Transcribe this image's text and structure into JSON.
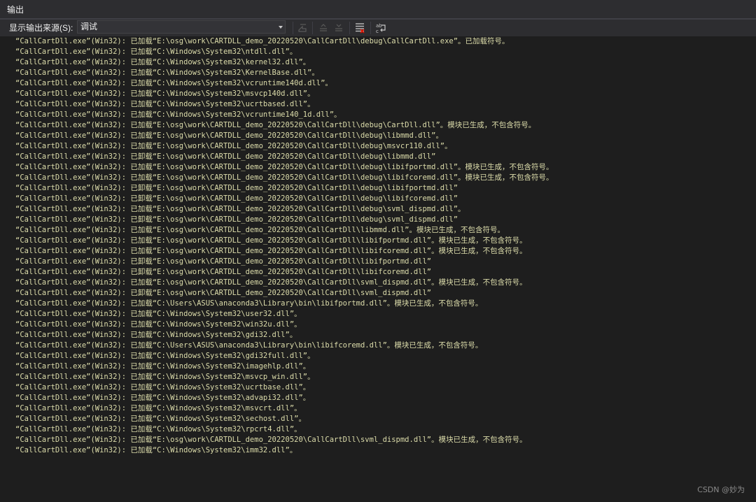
{
  "panel": {
    "title": "输出"
  },
  "toolbar": {
    "source_label": "显示输出来源(S):",
    "source_value": "调试",
    "buttons": [
      {
        "icon": "goto-line-icon",
        "enabled": false
      },
      {
        "icon": "previous-message-icon",
        "enabled": false
      },
      {
        "icon": "next-message-icon",
        "enabled": false
      },
      {
        "icon": "clear-all-icon",
        "enabled": true
      },
      {
        "icon": "word-wrap-icon",
        "enabled": true
      }
    ]
  },
  "output": {
    "lines": [
      "“CallCartDll.exe”(Win32): 已加载“E:\\osg\\work\\CARTDLL_demo_20220520\\CallCartDll\\debug\\CallCartDll.exe”。已加载符号。",
      "“CallCartDll.exe”(Win32): 已加载“C:\\Windows\\System32\\ntdll.dll”。",
      "“CallCartDll.exe”(Win32): 已加载“C:\\Windows\\System32\\kernel32.dll”。",
      "“CallCartDll.exe”(Win32): 已加载“C:\\Windows\\System32\\KernelBase.dll”。",
      "“CallCartDll.exe”(Win32): 已加载“C:\\Windows\\System32\\vcruntime140d.dll”。",
      "“CallCartDll.exe”(Win32): 已加载“C:\\Windows\\System32\\msvcp140d.dll”。",
      "“CallCartDll.exe”(Win32): 已加载“C:\\Windows\\System32\\ucrtbased.dll”。",
      "“CallCartDll.exe”(Win32): 已加载“C:\\Windows\\System32\\vcruntime140_1d.dll”。",
      "“CallCartDll.exe”(Win32): 已加载“E:\\osg\\work\\CARTDLL_demo_20220520\\CallCartDll\\debug\\CartDll.dll”。模块已生成，不包含符号。",
      "“CallCartDll.exe”(Win32): 已加载“E:\\osg\\work\\CARTDLL_demo_20220520\\CallCartDll\\debug\\libmmd.dll”。",
      "“CallCartDll.exe”(Win32): 已加载“E:\\osg\\work\\CARTDLL_demo_20220520\\CallCartDll\\debug\\msvcr110.dll”。",
      "“CallCartDll.exe”(Win32): 已卸载“E:\\osg\\work\\CARTDLL_demo_20220520\\CallCartDll\\debug\\libmmd.dll”",
      "“CallCartDll.exe”(Win32): 已加载“E:\\osg\\work\\CARTDLL_demo_20220520\\CallCartDll\\debug\\libifportmd.dll”。模块已生成，不包含符号。",
      "“CallCartDll.exe”(Win32): 已加载“E:\\osg\\work\\CARTDLL_demo_20220520\\CallCartDll\\debug\\libifcoremd.dll”。模块已生成，不包含符号。",
      "“CallCartDll.exe”(Win32): 已卸载“E:\\osg\\work\\CARTDLL_demo_20220520\\CallCartDll\\debug\\libifportmd.dll”",
      "“CallCartDll.exe”(Win32): 已卸载“E:\\osg\\work\\CARTDLL_demo_20220520\\CallCartDll\\debug\\libifcoremd.dll”",
      "“CallCartDll.exe”(Win32): 已加载“E:\\osg\\work\\CARTDLL_demo_20220520\\CallCartDll\\debug\\svml_dispmd.dll”。",
      "“CallCartDll.exe”(Win32): 已卸载“E:\\osg\\work\\CARTDLL_demo_20220520\\CallCartDll\\debug\\svml_dispmd.dll”",
      "“CallCartDll.exe”(Win32): 已加载“E:\\osg\\work\\CARTDLL_demo_20220520\\CallCartDll\\libmmd.dll”。模块已生成，不包含符号。",
      "“CallCartDll.exe”(Win32): 已加载“E:\\osg\\work\\CARTDLL_demo_20220520\\CallCartDll\\libifportmd.dll”。模块已生成，不包含符号。",
      "“CallCartDll.exe”(Win32): 已加载“E:\\osg\\work\\CARTDLL_demo_20220520\\CallCartDll\\libifcoremd.dll”。模块已生成，不包含符号。",
      "“CallCartDll.exe”(Win32): 已卸载“E:\\osg\\work\\CARTDLL_demo_20220520\\CallCartDll\\libifportmd.dll”",
      "“CallCartDll.exe”(Win32): 已卸载“E:\\osg\\work\\CARTDLL_demo_20220520\\CallCartDll\\libifcoremd.dll”",
      "“CallCartDll.exe”(Win32): 已加载“E:\\osg\\work\\CARTDLL_demo_20220520\\CallCartDll\\svml_dispmd.dll”。模块已生成，不包含符号。",
      "“CallCartDll.exe”(Win32): 已卸载“E:\\osg\\work\\CARTDLL_demo_20220520\\CallCartDll\\svml_dispmd.dll”",
      "“CallCartDll.exe”(Win32): 已加载“C:\\Users\\ASUS\\anaconda3\\Library\\bin\\libifportmd.dll”。模块已生成，不包含符号。",
      "“CallCartDll.exe”(Win32): 已加载“C:\\Windows\\System32\\user32.dll”。",
      "“CallCartDll.exe”(Win32): 已加载“C:\\Windows\\System32\\win32u.dll”。",
      "“CallCartDll.exe”(Win32): 已加载“C:\\Windows\\System32\\gdi32.dll”。",
      "“CallCartDll.exe”(Win32): 已加载“C:\\Users\\ASUS\\anaconda3\\Library\\bin\\libifcoremd.dll”。模块已生成，不包含符号。",
      "“CallCartDll.exe”(Win32): 已加载“C:\\Windows\\System32\\gdi32full.dll”。",
      "“CallCartDll.exe”(Win32): 已加载“C:\\Windows\\System32\\imagehlp.dll”。",
      "“CallCartDll.exe”(Win32): 已加载“C:\\Windows\\System32\\msvcp_win.dll”。",
      "“CallCartDll.exe”(Win32): 已加载“C:\\Windows\\System32\\ucrtbase.dll”。",
      "“CallCartDll.exe”(Win32): 已加载“C:\\Windows\\System32\\advapi32.dll”。",
      "“CallCartDll.exe”(Win32): 已加载“C:\\Windows\\System32\\msvcrt.dll”。",
      "“CallCartDll.exe”(Win32): 已加载“C:\\Windows\\System32\\sechost.dll”。",
      "“CallCartDll.exe”(Win32): 已加载“C:\\Windows\\System32\\rpcrt4.dll”。",
      "“CallCartDll.exe”(Win32): 已加载“E:\\osg\\work\\CARTDLL_demo_20220520\\CallCartDll\\svml_dispmd.dll”。模块已生成，不包含符号。",
      "“CallCartDll.exe”(Win32): 已加载“C:\\Windows\\System32\\imm32.dll”。"
    ]
  },
  "watermark": "CSDN @妙为",
  "colors": {
    "background": "#1e1e1e",
    "panel_header": "#2d2d30",
    "output_text": "#dcdcaa",
    "label_text": "#f1f1f1",
    "disabled_icon": "#5a5a5a",
    "enabled_icon": "#c8c8c8"
  }
}
